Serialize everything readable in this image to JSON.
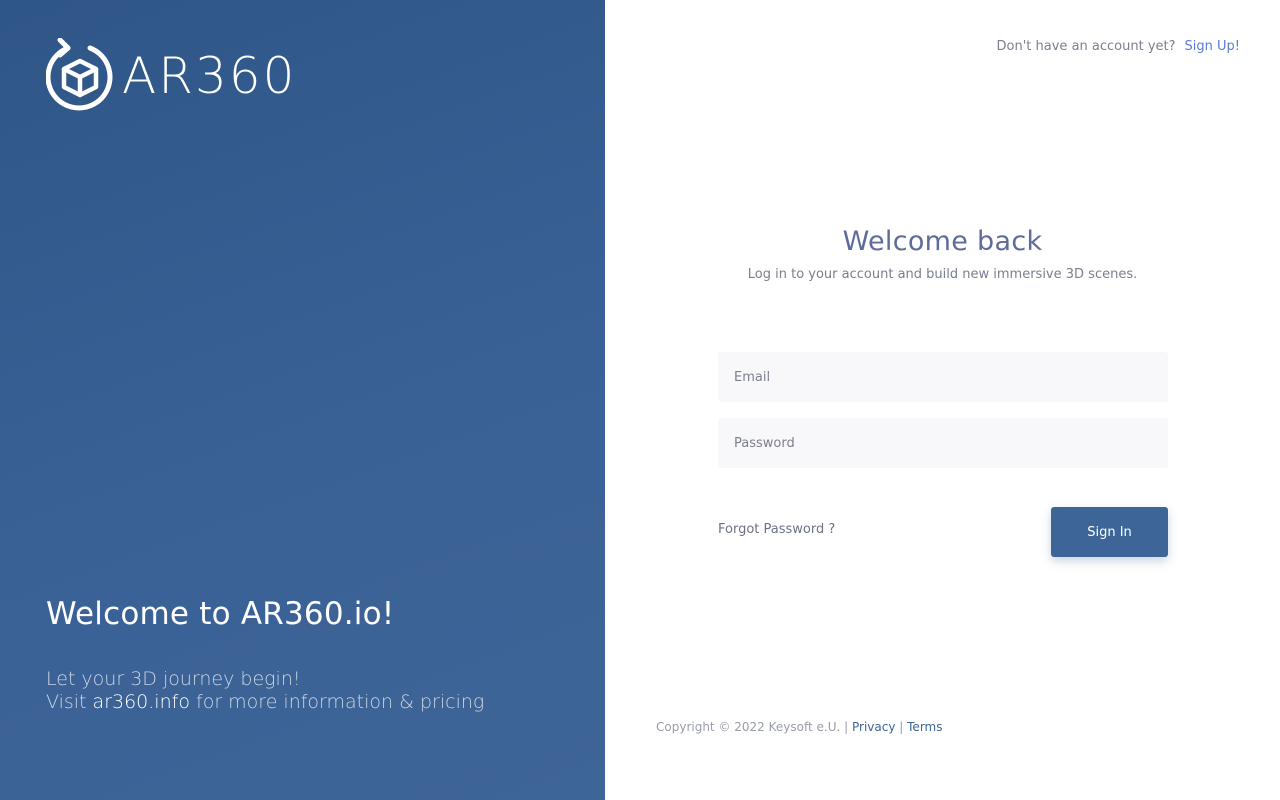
{
  "brand": {
    "logo_text": "AR360",
    "logo_icon": "cube-refresh-icon",
    "panel_color": "#3a6196"
  },
  "left": {
    "title": "Welcome to AR360.io!",
    "line1": "Let your 3D journey begin!",
    "visit_prefix": "Visit",
    "visit_link": "ar360.info",
    "visit_suffix": "for more information & pricing"
  },
  "topbar": {
    "question": "Don't have an account yet?",
    "signup_label": "Sign Up!"
  },
  "form": {
    "heading": "Welcome back",
    "subheading": "Log in to your account and build new immersive 3D scenes.",
    "email_placeholder": "Email",
    "password_placeholder": "Password",
    "forgot_label": "Forgot Password ?",
    "signin_label": "Sign In",
    "accent": "#3d6597"
  },
  "footer": {
    "copyright": "Copyright © 2022 Keysoft e.U. |",
    "privacy_label": "Privacy",
    "separator": "|",
    "terms_label": "Terms"
  }
}
